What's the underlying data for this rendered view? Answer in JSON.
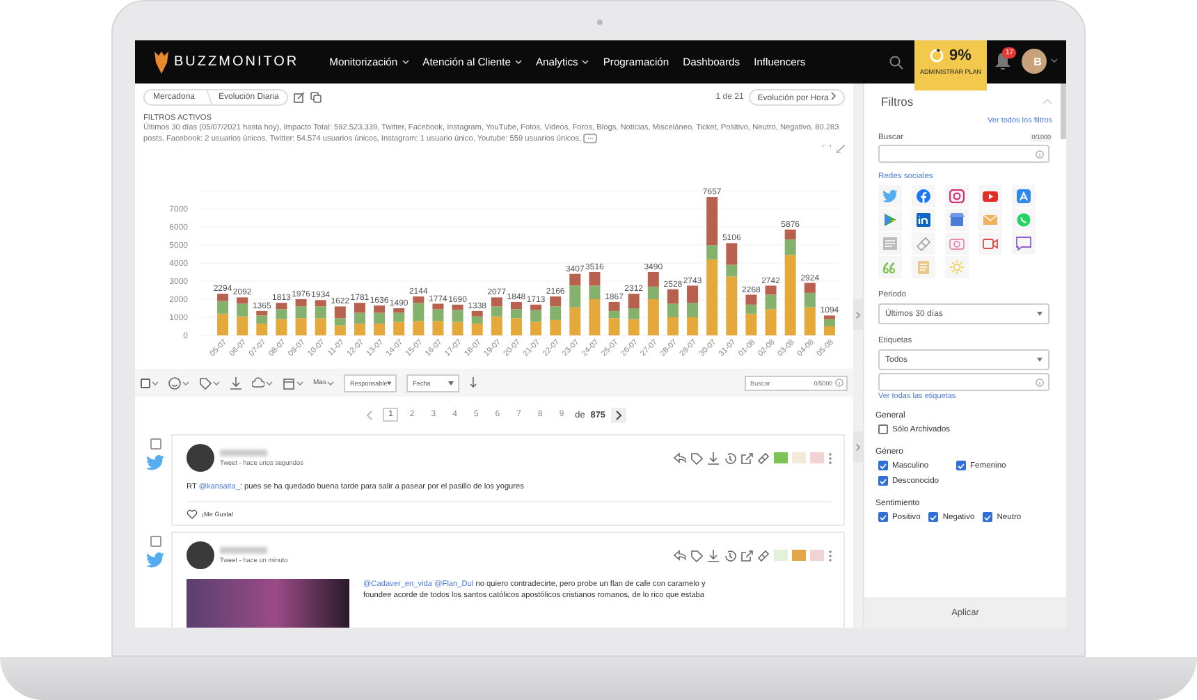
{
  "nav": {
    "logo": "**BUZZ**MONITOR",
    "items": [
      {
        "label": "Monitorización",
        "dropdown": true
      },
      {
        "label": "Atención al Cliente",
        "dropdown": true
      },
      {
        "label": "Analytics",
        "dropdown": true
      },
      {
        "label": "Programación",
        "dropdown": false
      },
      {
        "label": "Dashboards",
        "dropdown": false
      },
      {
        "label": "Influencers",
        "dropdown": false
      }
    ],
    "plan": {
      "percent": "9%",
      "level": 0.09,
      "label": "ADMINISTRAR PLAN"
    },
    "notifications": "17",
    "avatar": "B"
  },
  "header": {
    "breadcrumbs": [
      "Mercadona",
      "Evolución Diaria"
    ],
    "page": "1 de 21",
    "next_button": "Evolución por Hora"
  },
  "active_filters": {
    "title": "FILTROS ACTIVOS",
    "text": "Últimos 30 días (05/07/2021 hasta hoy), Impacto Total: 592.523.339, Twitter, Facebook, Instagram, YouTube, Fotos, Videos, Foros, Blogs, Noticias, Misceláneo, Ticket, Positivo, Neutro, Negativo, 80.283 posts, Facebook: 2 usuarios únicos, Twitter: 54.574 usuarios únicos, Instagram: 1 usuario único, Youtube: 559 usuarios únicos,",
    "more_button": "..."
  },
  "chart_data": {
    "type": "bar",
    "stacked": true,
    "categories": [
      "05-07",
      "06-07",
      "07-07",
      "08-07",
      "09-07",
      "10-07",
      "11-07",
      "12-07",
      "13-07",
      "14-07",
      "15-07",
      "16-07",
      "17-07",
      "18-07",
      "19-07",
      "20-07",
      "21-07",
      "22-07",
      "23-07",
      "24-07",
      "25-07",
      "26-07",
      "27-07",
      "28-07",
      "29-07",
      "30-07",
      "31-07",
      "01-08",
      "02-08",
      "03-08",
      "04-08",
      "05-08"
    ],
    "series": [
      {
        "color": "#e5a83b",
        "values": [
          1200,
          1050,
          650,
          900,
          950,
          950,
          550,
          650,
          650,
          750,
          800,
          800,
          750,
          650,
          1050,
          950,
          750,
          850,
          1550,
          2000,
          950,
          900,
          2000,
          1000,
          1000,
          4200,
          3250,
          1200,
          1450,
          4450,
          1550,
          500
        ]
      },
      {
        "color": "#84b26d",
        "values": [
          700,
          700,
          450,
          550,
          650,
          650,
          400,
          600,
          600,
          500,
          1000,
          650,
          650,
          400,
          550,
          500,
          650,
          750,
          1200,
          750,
          400,
          600,
          700,
          750,
          800,
          800,
          650,
          500,
          800,
          850,
          800,
          400
        ]
      },
      {
        "color": "#b9614f",
        "values": [
          400,
          350,
          250,
          350,
          400,
          350,
          650,
          550,
          400,
          250,
          350,
          300,
          300,
          300,
          500,
          400,
          300,
          550,
          650,
          750,
          500,
          800,
          800,
          800,
          950,
          2650,
          1200,
          550,
          500,
          550,
          550,
          200
        ]
      }
    ],
    "value_labels": [
      "2294",
      "2092",
      "1365",
      "1813",
      "1976",
      "1934",
      "1622",
      "1781",
      "1636",
      "1490",
      "2144",
      "1774",
      "1690",
      "1338",
      "2077",
      "1848",
      "1713",
      "2166",
      "3407",
      "3516",
      "1867",
      "2312",
      "3490",
      "2528",
      "2743",
      "7657",
      "5106",
      "2268",
      "2742",
      "5876",
      "2924",
      "1094"
    ],
    "grid": true,
    "ylim": [
      0,
      8000
    ],
    "yticks": [
      0,
      1000,
      2000,
      3000,
      4000,
      5000,
      6000,
      7000
    ]
  },
  "toolbar": {
    "select_all": {
      "checked": false
    },
    "more": "Mas",
    "selects": [
      "Responsable",
      "Fecha"
    ],
    "search": {
      "placeholder": "Buscar",
      "counter": "0/5000"
    }
  },
  "pagination": {
    "pages": [
      {
        "label": "1",
        "selected": true
      },
      {
        "label": "2",
        "selected": false
      },
      {
        "label": "3",
        "selected": false
      },
      {
        "label": "4",
        "selected": false
      },
      {
        "label": "5",
        "selected": false
      },
      {
        "label": "6",
        "selected": false
      },
      {
        "label": "7",
        "selected": false
      },
      {
        "label": "8",
        "selected": false
      },
      {
        "label": "9",
        "selected": false
      }
    ],
    "of": "de",
    "total": "875"
  },
  "posts": [
    {
      "checked": false,
      "meta": "Tweet - hace unos segundos",
      "segments": [
        {
          "kind": "plain",
          "text": "RT "
        },
        {
          "kind": "mention",
          "text": "@kansaita_"
        },
        {
          "kind": "plain",
          "text": ": pues se ha quedado buena tarde para salir a pasear por el pasillo de los yogures"
        }
      ],
      "sentiment": [
        {
          "kind": "positive",
          "selected": true
        },
        {
          "kind": "neutral",
          "selected": false
        },
        {
          "kind": "negative",
          "selected": false
        }
      ],
      "like": "¡Me Gusta!"
    },
    {
      "checked": false,
      "meta": "Tweet - hace un minuto",
      "media": true,
      "segments": [
        {
          "kind": "mention",
          "text": "@Cadaver_en_vida"
        },
        {
          "kind": "mention",
          "text": "@Flan_Dul"
        },
        {
          "kind": "plain",
          "text": " no quiero contradecirte, pero probe un flan de cafe con caramelo y foundee acorde de todos los santos católicos apostólicos cristianos romanos, de lo rico que estaba"
        }
      ],
      "sentiment": [
        {
          "kind": "positive",
          "selected": false
        },
        {
          "kind": "neutral",
          "selected": true
        },
        {
          "kind": "negative",
          "selected": false
        }
      ]
    }
  ],
  "sidebar": {
    "title": "Filtros",
    "all_filters": "Ver todos los filtros",
    "search_label": "Buscar",
    "search_counter": "0/1000",
    "networks_label": "Redes sociales",
    "period": {
      "label": "Periodo",
      "value": "Últimos 30 días"
    },
    "tags": {
      "label": "Etiquetas",
      "value": "Todos",
      "all": "Ver todas las etiquetas"
    },
    "groups": [
      {
        "title": "General",
        "options": [
          {
            "label": "Sólo Archivados",
            "checked": false
          }
        ]
      },
      {
        "title": "Género",
        "options": [
          {
            "label": "Masculino",
            "checked": true
          },
          {
            "label": "Femenino",
            "checked": true
          },
          {
            "label": "Desconocido",
            "checked": true
          }
        ]
      },
      {
        "title": "Sentimiento",
        "options": [
          {
            "label": "Positivo",
            "checked": true
          },
          {
            "label": "Negativo",
            "checked": true
          },
          {
            "label": "Neutro",
            "checked": true
          }
        ]
      }
    ],
    "apply": "Aplicar"
  }
}
